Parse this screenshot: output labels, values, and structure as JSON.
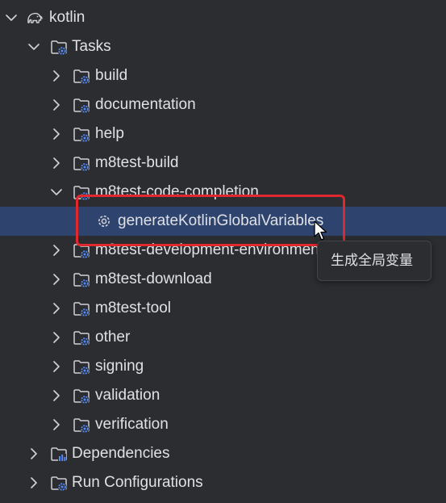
{
  "tree": {
    "root": {
      "label": "kotlin",
      "icon": "elephant-icon",
      "expanded": true
    },
    "tasks": {
      "label": "Tasks",
      "icon": "task-folder-icon",
      "expanded": true
    },
    "task_groups": [
      {
        "label": "build",
        "expanded": false
      },
      {
        "label": "documentation",
        "expanded": false
      },
      {
        "label": "help",
        "expanded": false
      },
      {
        "label": "m8test-build",
        "expanded": false
      },
      {
        "label": "m8test-code-completion",
        "expanded": true
      },
      {
        "label": "m8test-development-environment",
        "expanded": false
      },
      {
        "label": "m8test-download",
        "expanded": false
      },
      {
        "label": "m8test-tool",
        "expanded": false
      },
      {
        "label": "other",
        "expanded": false
      },
      {
        "label": "signing",
        "expanded": false
      },
      {
        "label": "validation",
        "expanded": false
      },
      {
        "label": "verification",
        "expanded": false
      }
    ],
    "selected_task": {
      "label": "generateKotlinGlobalVariables",
      "icon": "gear-icon"
    },
    "dependencies": {
      "label": "Dependencies",
      "icon": "dependencies-folder-icon",
      "expanded": false
    },
    "run_configurations": {
      "label": "Run Configurations",
      "icon": "run-config-folder-icon",
      "expanded": false
    }
  },
  "tooltip": {
    "text": "生成全局变量"
  },
  "colors": {
    "background": "#2b2d30",
    "selection": "#2e436e",
    "text": "#dfe1e5",
    "annotation_box": "#e0282e",
    "gear_badge": "#3574f0"
  }
}
